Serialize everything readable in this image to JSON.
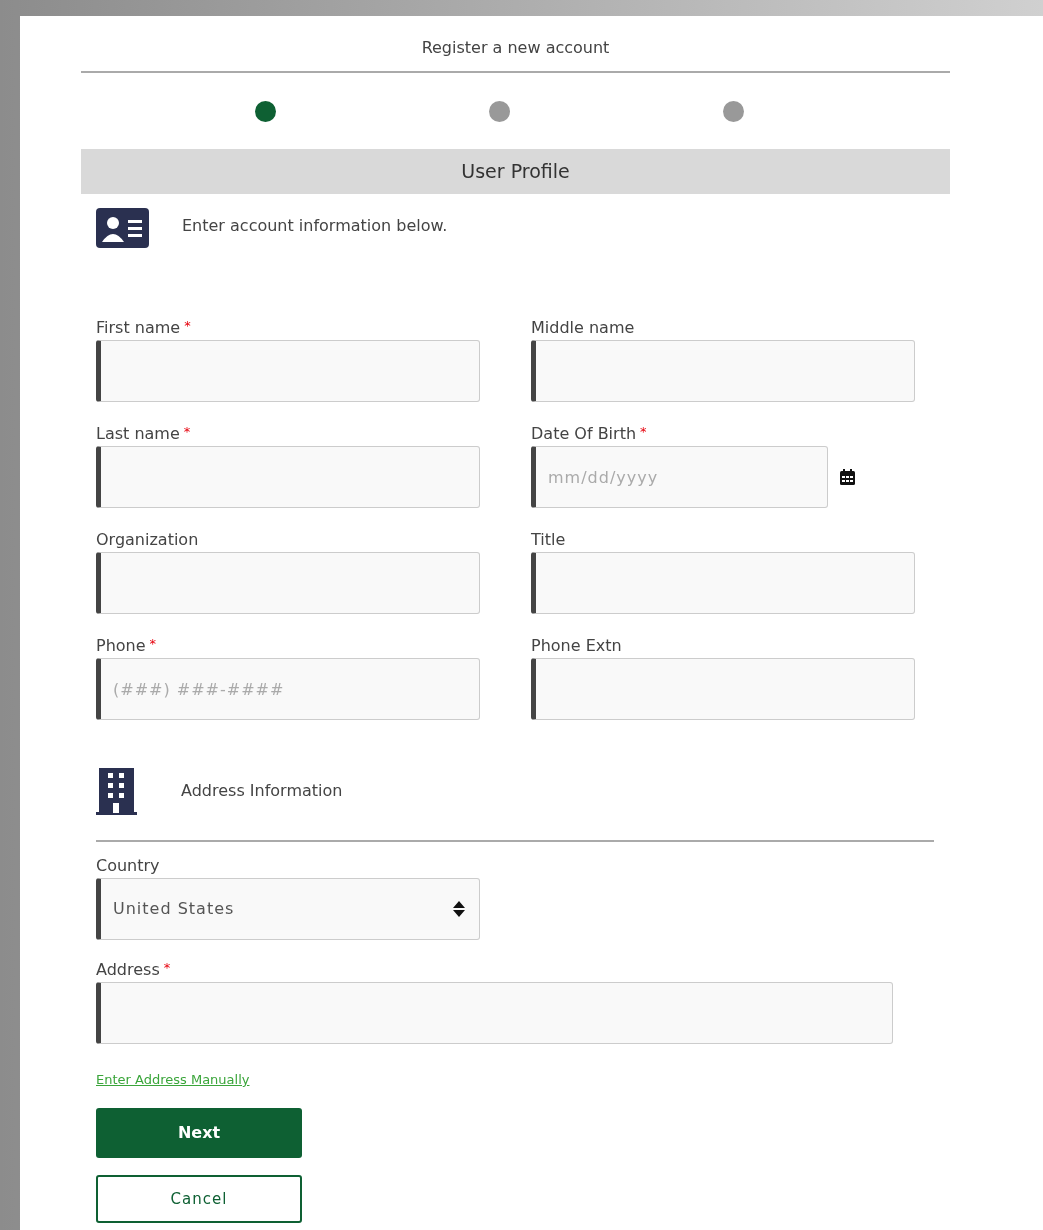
{
  "header": {
    "title": "Register a new account"
  },
  "steps": [
    {
      "selected": true
    },
    {
      "selected": false
    },
    {
      "selected": false
    }
  ],
  "section": {
    "title": "User Profile",
    "intro": "Enter account information below."
  },
  "fields": [
    {
      "kind": "text",
      "label": "First name",
      "required_mark": "*"
    },
    {
      "kind": "text",
      "label": "Middle name"
    },
    {
      "kind": "text",
      "label": "Last name",
      "required_mark": "*"
    },
    {
      "kind": "date",
      "label": "Date Of Birth",
      "required_mark": "*",
      "placeholder": "mm/dd/yyyy"
    },
    {
      "kind": "text",
      "label": "Organization"
    },
    {
      "kind": "text",
      "label": "Title"
    },
    {
      "kind": "text",
      "label": "Phone",
      "required_mark": "*",
      "placeholder": "(###) ###-####"
    },
    {
      "kind": "text",
      "label": "Phone Extn"
    }
  ],
  "address": {
    "title": "Address Information",
    "country": {
      "label": "Country",
      "value": "United States"
    },
    "address": {
      "label": "Address",
      "required_mark": "*"
    },
    "manual_link": "Enter Address Manually"
  },
  "buttons": [
    {
      "kind": "primary",
      "label": "Next"
    },
    {
      "kind": "secondary",
      "label": "Cancel"
    }
  ]
}
